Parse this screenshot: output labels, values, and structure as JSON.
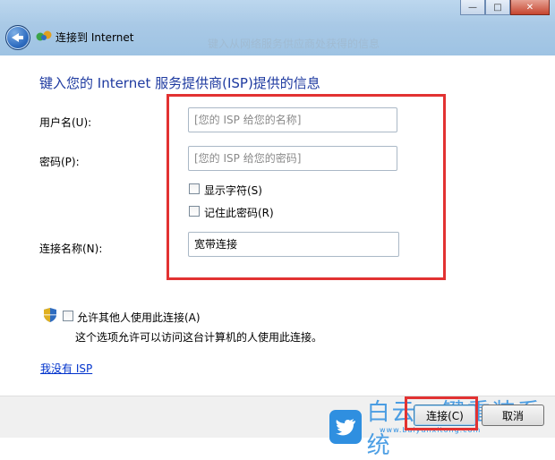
{
  "window": {
    "title": "连接到 Internet",
    "ghost_text": "键入从网络服务供应商处获得的信息"
  },
  "caption_buttons": {
    "minimize": "—",
    "maximize": "□",
    "close": "✕"
  },
  "heading": "键入您的 Internet 服务提供商(ISP)提供的信息",
  "form": {
    "username": {
      "label": "用户名(U):",
      "placeholder": "[您的 ISP 给您的名称]"
    },
    "password": {
      "label": "密码(P):",
      "placeholder": "[您的 ISP 给您的密码]"
    },
    "show_chars": {
      "label": "显示字符(S)",
      "checked": false
    },
    "remember": {
      "label": "记住此密码(R)",
      "checked": false
    },
    "connection_name": {
      "label": "连接名称(N):",
      "value": "宽带连接"
    }
  },
  "allow_others": {
    "label": "允许其他人使用此连接(A)",
    "checked": false,
    "description": "这个选项允许可以访问这台计算机的人使用此连接。"
  },
  "no_isp_link": "我没有 ISP",
  "buttons": {
    "connect": "连接(C)",
    "cancel": "取消"
  },
  "watermark": {
    "text": "白云一键重装系统",
    "sub": "www.baiyunxitong.com"
  },
  "colors": {
    "highlight": "#e23232",
    "heading": "#1e3aa0",
    "link": "#0033cc"
  }
}
